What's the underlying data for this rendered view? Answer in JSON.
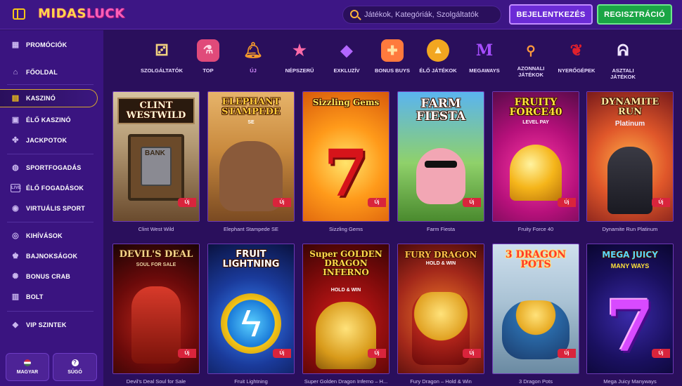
{
  "header": {
    "logo": "MIDAS LUCK",
    "logo_part1": "MIDAS",
    "logo_part2": "LUCK",
    "search_placeholder": "Játékok, Kategóriák, Szolgáltatók",
    "login_label": "BEJELENTKEZÉS",
    "register_label": "REGISZTRÁCIÓ"
  },
  "sidebar": {
    "items": [
      {
        "label": "PROMÓCIÓK",
        "icon": "gift-icon"
      },
      {
        "label": "FŐOLDAL",
        "icon": "home-icon"
      },
      {
        "label": "KASZINÓ",
        "icon": "slot-machine-icon",
        "active": true
      },
      {
        "label": "ÉLŐ KASZINÓ",
        "icon": "live-casino-icon"
      },
      {
        "label": "JACKPOTOK",
        "icon": "clover-icon"
      },
      {
        "label": "SPORTFOGADÁS",
        "icon": "ball-icon"
      },
      {
        "label": "ÉLŐ FOGADÁSOK",
        "icon": "live-badge-icon"
      },
      {
        "label": "VIRTUÁLIS SPORT",
        "icon": "gamepad-icon"
      },
      {
        "label": "KIHÍVÁSOK",
        "icon": "target-icon"
      },
      {
        "label": "BAJNOKSÁGOK",
        "icon": "trophy-icon"
      },
      {
        "label": "BONUS CRAB",
        "icon": "crab-icon"
      },
      {
        "label": "BOLT",
        "icon": "basket-icon"
      },
      {
        "label": "VIP SZINTEK",
        "icon": "diamond-icon"
      }
    ],
    "language_label": "MAGYAR",
    "help_label": "SÚGÓ"
  },
  "categories": [
    {
      "label": "SZOLGÁLTATÓK",
      "icon": "dice-icon"
    },
    {
      "label": "TOP",
      "icon": "potion-icon"
    },
    {
      "label": "ÚJ",
      "icon": "bell-icon",
      "active": true
    },
    {
      "label": "NÉPSZERŰ",
      "icon": "star-icon"
    },
    {
      "label": "EXKLUZÍV",
      "icon": "gem-icon"
    },
    {
      "label": "BONUS BUYS",
      "icon": "gift-box-icon"
    },
    {
      "label": "ÉLŐ JÁTÉKOK",
      "icon": "coin-icon"
    },
    {
      "label": "MEGAWAYS",
      "icon": "letter-m-icon"
    },
    {
      "label": "AZONNALI JÁTÉKOK",
      "icon": "joystick-icon"
    },
    {
      "label": "NYERŐGÉPEK",
      "icon": "cherry-icon"
    },
    {
      "label": "ASZTALI JÁTÉKOK",
      "icon": "bunny-icon"
    }
  ],
  "games": [
    {
      "name": "Clint West Wild",
      "art_title": "CLINT WESTWILD",
      "badge": "Új"
    },
    {
      "name": "Elephant Stampede SE",
      "art_title": "ELEPHANT STAMPEDE",
      "art_sub": "SE",
      "badge": "Új"
    },
    {
      "name": "Sizzling Gems",
      "art_title": "Sizzling Gems",
      "badge": "Új"
    },
    {
      "name": "Farm Fiesta",
      "art_title": "FARM FIESTA",
      "badge": "Új"
    },
    {
      "name": "Fruity Force 40",
      "art_title": "FRUITY FORCE40",
      "art_sub": "LEVEL PAY",
      "badge": "Új"
    },
    {
      "name": "Dynamite Run Platinum",
      "art_title": "DYNAMITE RUN",
      "art_sub": "Platinum",
      "badge": "Új"
    },
    {
      "name": "Devil's Deal Soul for Sale",
      "art_title": "DEVIL'S DEAL",
      "art_sub": "SOUL FOR SALE",
      "badge": "Új"
    },
    {
      "name": "Fruit Lightning",
      "art_title": "FRUIT LIGHTNING",
      "badge": "Új"
    },
    {
      "name": "Super Golden Dragon Inferno – H...",
      "art_title": "Super GOLDEN DRAGON INFERNO",
      "art_sub": "HOLD & WIN",
      "badge": "Új"
    },
    {
      "name": "Fury Dragon – Hold & Win",
      "art_title": "FURY DRAGON",
      "art_sub": "HOLD & WIN",
      "badge": "Új"
    },
    {
      "name": "3 Dragon Pots",
      "art_title": "3 DRAGON POTS",
      "badge": "Új"
    },
    {
      "name": "Mega Juicy Manyways",
      "art_title": "MEGA JUICY",
      "art_sub": "MANY WAYS",
      "badge": "Új"
    }
  ],
  "colors": {
    "background": "#2a0f5c",
    "sidebar": "#3a1480",
    "accent_gold": "#f5c518",
    "login_button": "#6b2bd6",
    "register_button": "#1aa545",
    "new_badge": "#d9243c"
  }
}
